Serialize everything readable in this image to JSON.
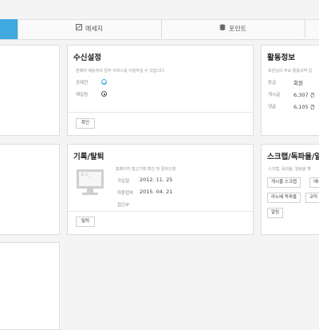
{
  "colors": {
    "accent": "#3fa9e0",
    "panel_border": "#dedede",
    "background": "#f4f4f4"
  },
  "tabs": [
    {
      "label": "",
      "active": true
    },
    {
      "label": "메세지",
      "icon": "message-icon"
    },
    {
      "label": "포인트",
      "icon": "coins-icon"
    }
  ],
  "receive_settings": {
    "title": "수신설정",
    "description": "판매자 배송처의 일부 서비스를 이용하실 수 있습니다.",
    "rows": [
      {
        "label": "공제전",
        "icon": "check-circle-icon"
      },
      {
        "label": "메일링",
        "icon": "radio-selected-icon"
      }
    ],
    "dot": "·",
    "confirm_button": "확인"
  },
  "activity_info": {
    "title": "활동정보",
    "description": "회원님의 주요 활동내역 입",
    "rows": [
      {
        "label": "등급",
        "value": "회원"
      },
      {
        "label": "게시글",
        "value": "6,307 건"
      },
      {
        "label": "댓글",
        "value": "6,105 건"
      }
    ]
  },
  "record_withdraw": {
    "title": "기록/탈퇴",
    "description": "홈페이지 접근기록 확인 및 탈퇴신청",
    "rows": [
      {
        "label": "가입일",
        "value": "2012. 11. 25"
      },
      {
        "label": "최종접속",
        "value": "2015. 04. 21"
      },
      {
        "label": "접근IP",
        "value": ""
      }
    ],
    "computer_screen_text": "C:/_",
    "withdraw_button": "탈퇴"
  },
  "scrap": {
    "title": "스크랩/독파율/알",
    "description": "스크랩, 독파율, 알림을 확",
    "buttons": [
      "게시물 스크랩",
      "애니스",
      "라노베 독파율",
      "코믹 독",
      "알림"
    ]
  }
}
